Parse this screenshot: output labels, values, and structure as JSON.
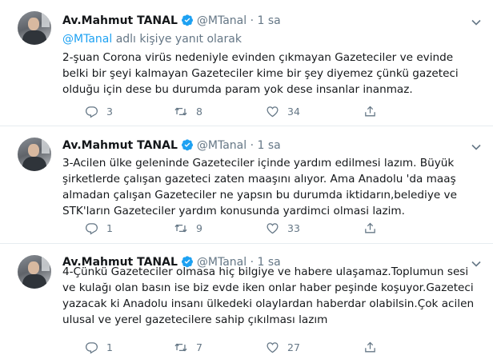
{
  "colors": {
    "text": "#14171a",
    "secondary": "#657786",
    "accent": "#1da1f2",
    "divider": "#e6ecf0"
  },
  "tweets": [
    {
      "author_name": "Av.Mahmut TANAL",
      "handle": "@MTanal",
      "separator": "·",
      "time": "1 sa",
      "replying_mention": "@MTanal",
      "replying_suffix": "adlı kişiye yanıt olarak",
      "text": "2-şuan Corona virüs nedeniyle evinden çıkmayan Gazeteciler ve evinde belki bir şeyi kalmayan Gazeteciler kime bir şey diyemez çünkü gazeteci olduğu için dese bu durumda param yok dese insanlar inanmaz.",
      "replies": "3",
      "retweets": "8",
      "likes": "34"
    },
    {
      "author_name": "Av.Mahmut TANAL",
      "handle": "@MTanal",
      "separator": "·",
      "time": "1 sa",
      "text": "3-Acilen ülke geleninde  Gazeteciler içinde yardım edilmesi lazım. Büyük şirketlerde çalışan gazeteci zaten maaşını alıyor. Ama Anadolu 'da  maaş almadan çalışan Gazeteciler ne yapsın  bu durumda iktidarın,belediye ve STK'ların Gazeteciler yardım konusunda yardimci olmasi lazim.",
      "replies": "1",
      "retweets": "9",
      "likes": "33"
    },
    {
      "author_name": "Av.Mahmut TANAL",
      "handle": "@MTanal",
      "separator": "·",
      "time": "1 sa",
      "text": "4-Çünkü Gazeteciler olmasa hiç bilgiye ve habere ulaşamaz.Toplumun sesi ve kulağı olan basın ise biz evde iken onlar haber peşinde koşuyor.Gazeteci yazacak ki Anadolu insanı ülkedeki olaylardan haberdar olabilsin.Çok acilen ulusal ve yerel gazetecilere sahip çıkılması lazım",
      "replies": "1",
      "retweets": "7",
      "likes": "27"
    }
  ]
}
